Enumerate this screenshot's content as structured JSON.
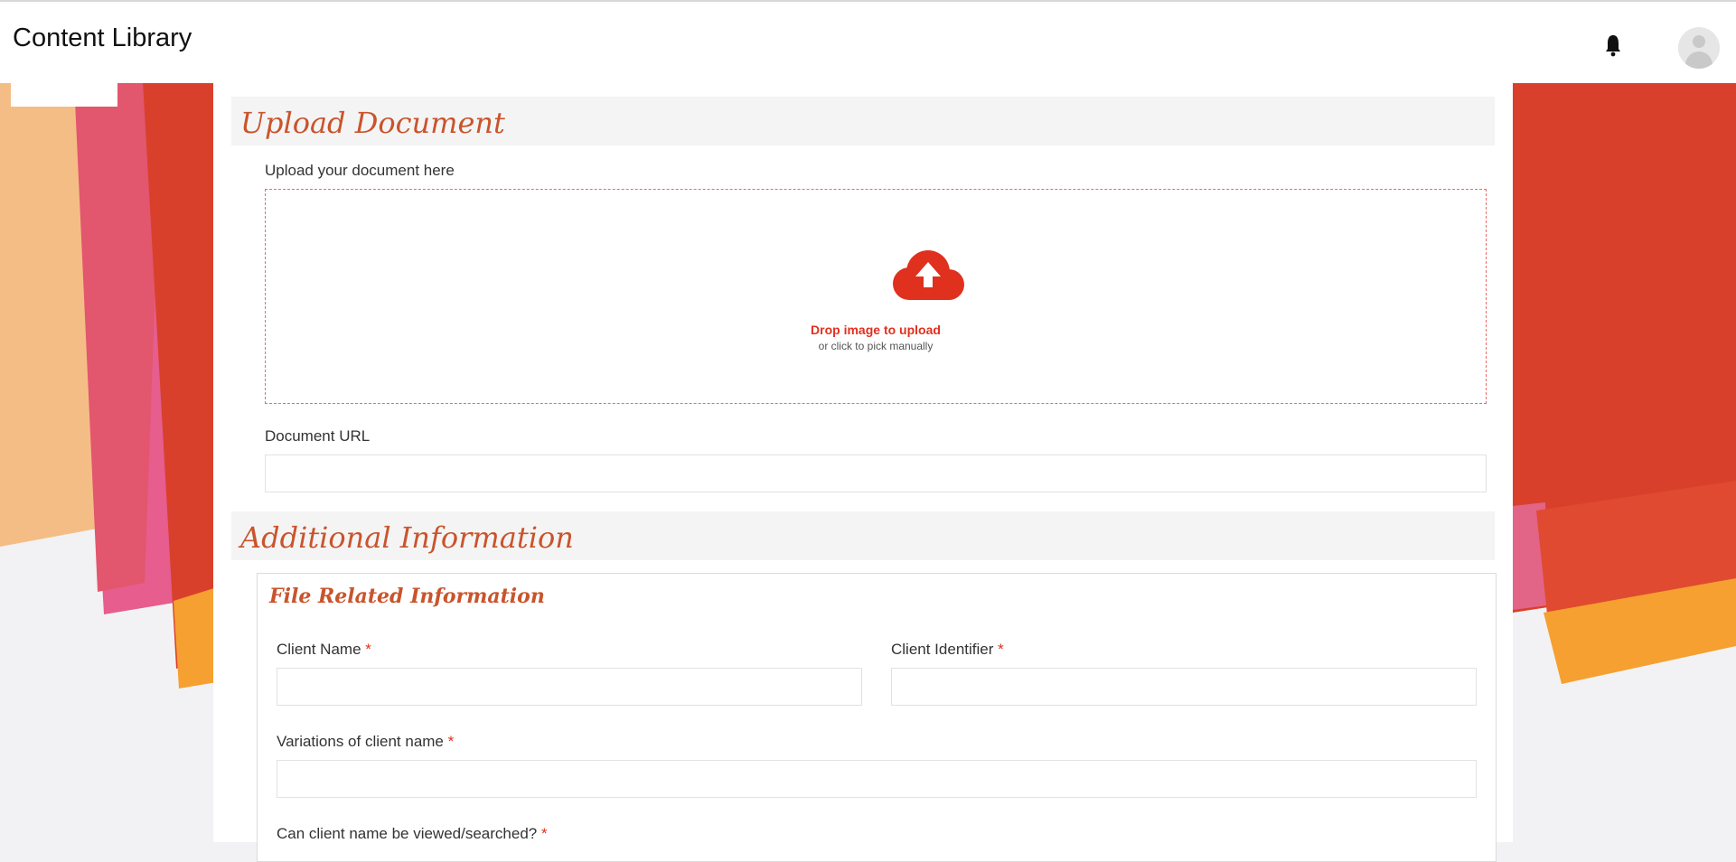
{
  "app": {
    "title": "Content Library"
  },
  "header": {
    "notification_icon": "bell-icon",
    "avatar_icon": "user-avatar-icon"
  },
  "colors": {
    "accent": "#e0301e",
    "title": "#c9542c",
    "orange": "#f5a030",
    "red": "#d9402c",
    "pink": "#e2566e",
    "peach": "#f5bd86"
  },
  "upload": {
    "section_title": "Upload Document",
    "label": "Upload your document here",
    "dropzone_icon": "cloud-upload-icon",
    "dropzone_title": "Drop image to upload",
    "dropzone_subtitle": "or click to pick manually",
    "url_label": "Document URL",
    "url_value": ""
  },
  "additional": {
    "section_title": "Additional Information",
    "file_info_title": "File Related Information",
    "required_marker": "*",
    "client_name_label": "Client Name",
    "client_name_value": "",
    "client_identifier_label": "Client Identifier",
    "client_identifier_value": "",
    "variations_label": "Variations of client name",
    "variations_value": "",
    "viewable_label": "Can client name be viewed/searched?"
  }
}
